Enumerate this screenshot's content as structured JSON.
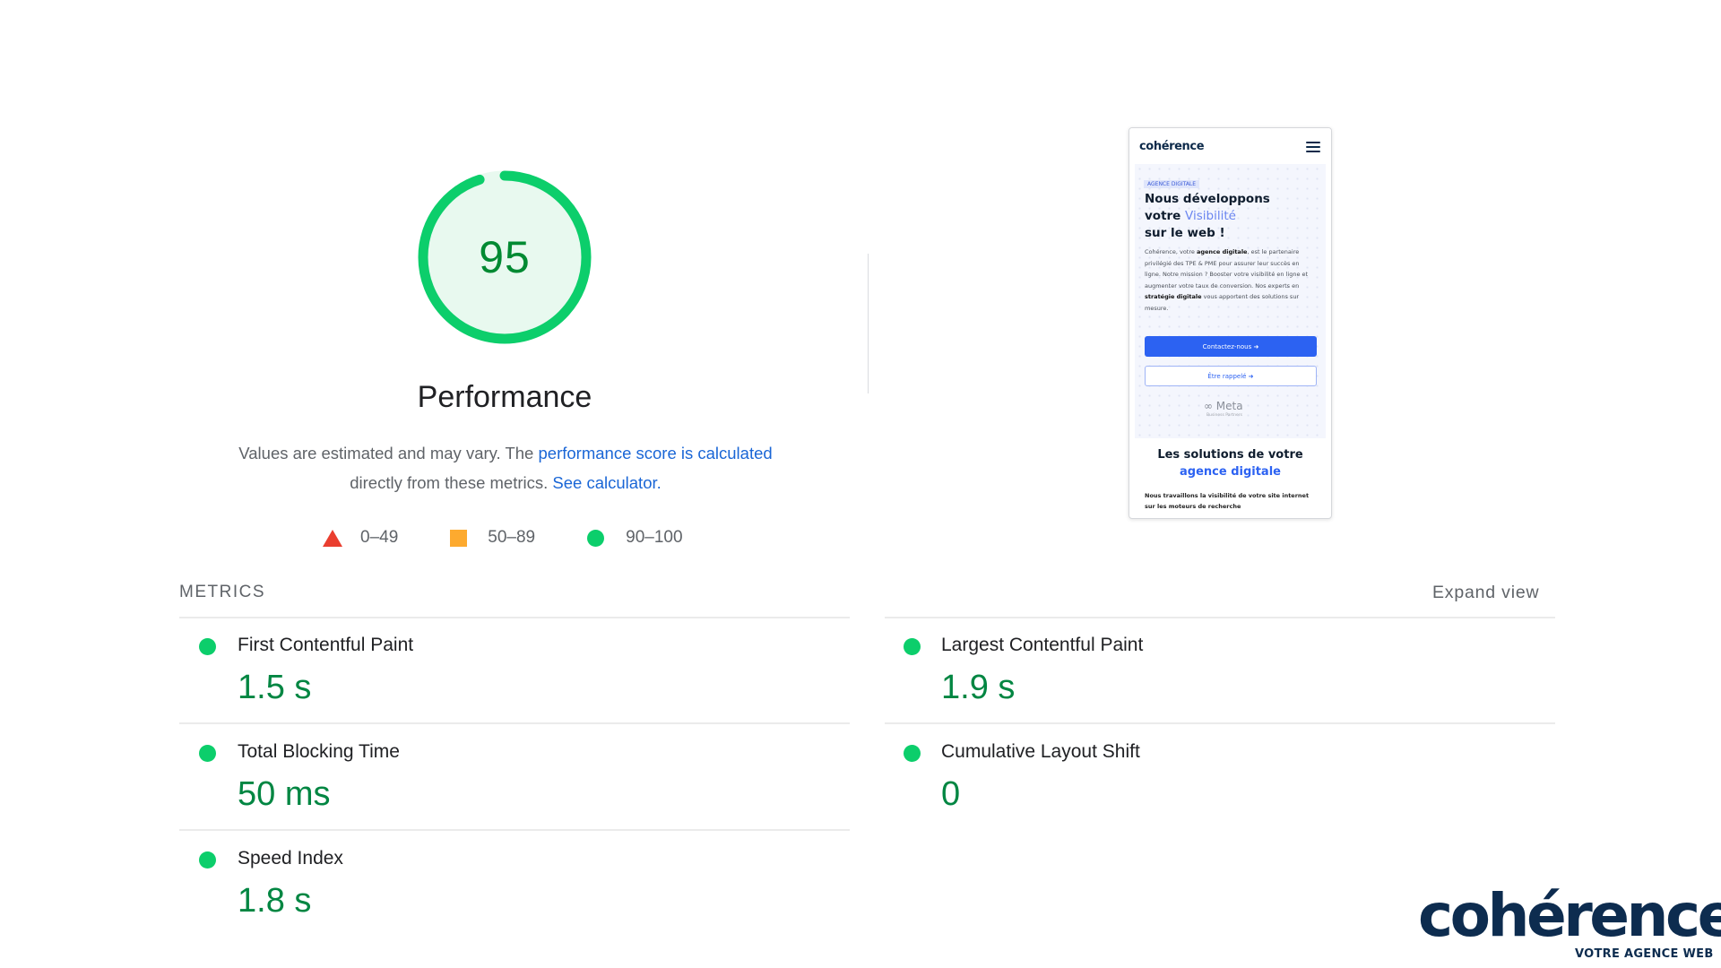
{
  "gauge": {
    "score": "95",
    "score_fraction": 0.95,
    "title": "Performance",
    "ring_color": "#0cce6b",
    "fill_color": "#e8f9ef",
    "score_color": "#008a32"
  },
  "description": {
    "part1": "Values are estimated and may vary. The ",
    "link1": "performance score is calculated",
    "part2": " directly from these metrics. ",
    "link2": "See calculator."
  },
  "legend": [
    {
      "shape": "triangle",
      "color": "#ea3e2f",
      "range": "0–49"
    },
    {
      "shape": "square",
      "color": "#fdaa2f",
      "range": "50–89"
    },
    {
      "shape": "circle",
      "color": "#0cce6b",
      "range": "90–100"
    }
  ],
  "thumbnail": {
    "logo": "cohérence",
    "menu_icon": "hamburger-icon",
    "badge": "AGENCE DIGITALE",
    "heading_line1": "Nous développons",
    "heading_line2_a": "votre ",
    "heading_line2_b": "Visibilité",
    "heading_line3": "sur le web !",
    "text_a": "Cohérence, votre ",
    "text_b": "agence digitale",
    "text_c": ", est le partenaire privilégié des TPE & PME pour assurer leur succès en ligne. Notre mission ? Booster votre visibilité en ligne et augmenter votre taux de conversion. Nos experts en ",
    "text_d": "stratégie digitale",
    "text_e": " vous apportent des solutions sur mesure.",
    "button_primary": "Contactez-nous ➜",
    "button_secondary": "Être rappelé ➜",
    "meta_logo": "∞ Meta",
    "meta_sub": "Business Partners",
    "section_title_a": "Les solutions de votre",
    "section_title_b": "agence digitale",
    "small_text": "Nous travaillons la visibilité de votre site internet sur les moteurs de recherche"
  },
  "metrics": {
    "title": "METRICS",
    "expand": "Expand view",
    "items": [
      {
        "label": "First Contentful Paint",
        "value": "1.5 s",
        "status_color": "#0cce6b"
      },
      {
        "label": "Largest Contentful Paint",
        "value": "1.9 s",
        "status_color": "#0cce6b"
      },
      {
        "label": "Total Blocking Time",
        "value": "50 ms",
        "status_color": "#0cce6b"
      },
      {
        "label": "Cumulative Layout Shift",
        "value": "0",
        "status_color": "#0cce6b"
      },
      {
        "label": "Speed Index",
        "value": "1.8 s",
        "status_color": "#0cce6b"
      }
    ]
  },
  "brand": {
    "name": "cohérence",
    "tagline": "VOTRE AGENCE WEB",
    "color": "#0d2c4f"
  }
}
